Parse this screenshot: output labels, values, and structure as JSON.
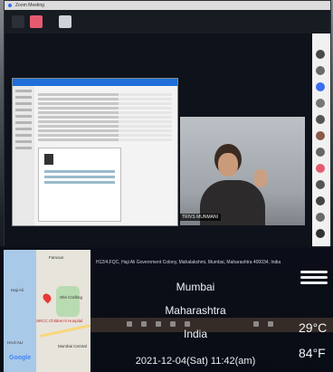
{
  "window": {
    "title": "Zoom Meeting"
  },
  "video": {
    "name_tag": "TRIVS MUNMANI"
  },
  "map": {
    "labels": [
      "Famous",
      "Haji Ali",
      "Shri Crafting",
      "SRCC Children's Hospital",
      "HAJI ALI",
      "Mumbai Central"
    ],
    "provider": "Google"
  },
  "geotag": {
    "address": "H12/4,FQC, Haji Ali Government Colony, Mahalakshmi, Mumbai, Maharashtra 400034, India",
    "city": "Mumbai",
    "state": "Maharashtra",
    "country": "India",
    "datetime": "2021-12-04(Sat) 11:42(am)",
    "temp_c": "29°C",
    "temp_f": "84°F",
    "weather_icon": "haze-icon"
  },
  "colors": {
    "accent": "#3b6ef0",
    "alert": "#e45b6f"
  }
}
